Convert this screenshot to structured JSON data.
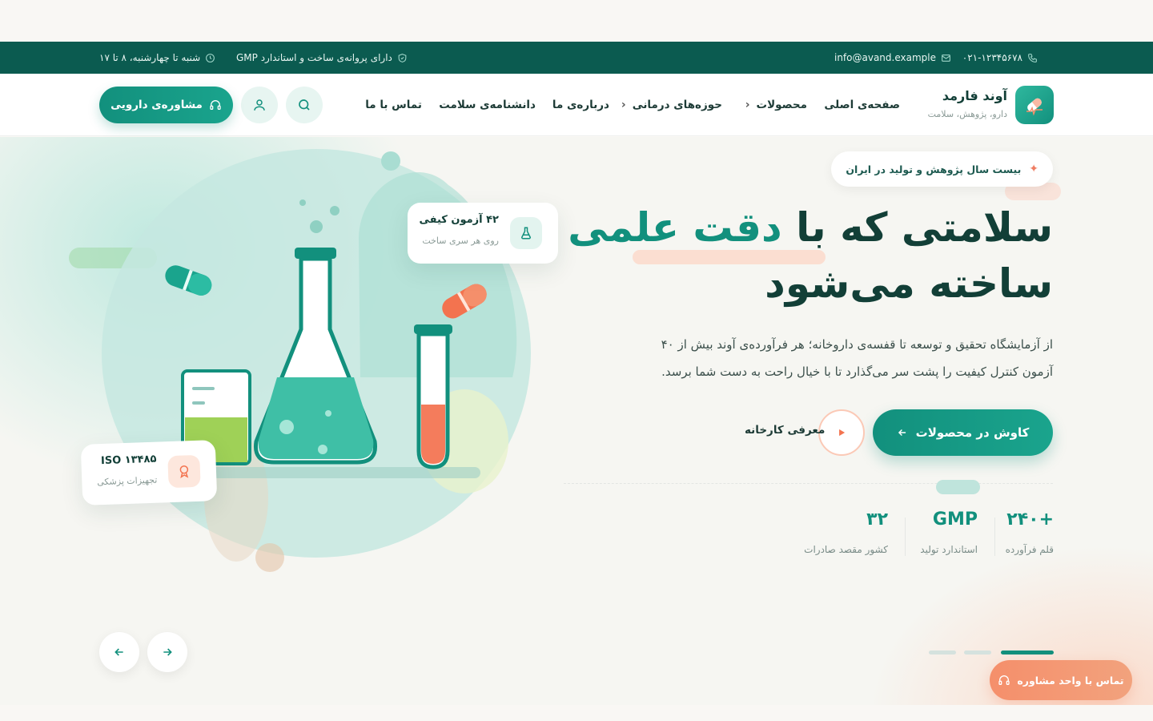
{
  "topbar": {
    "phone": "۰۲۱-۱۲۳۴۵۶۷۸",
    "email": "info@avand.example",
    "license": "دارای پروانه‌ی ساخت و استاندارد GMP",
    "hours": "شنبه تا چهارشنبه، ۸ تا ۱۷"
  },
  "brand": {
    "name": "آوند فارمد",
    "tagline": "دارو، پژوهش، سلامت"
  },
  "nav": {
    "items": [
      "صفحه‌ی اصلی",
      "محصولات",
      "حوزه‌های درمانی",
      "درباره‌ی ما",
      "دانشنامه‌ی سلامت",
      "تماس با ما"
    ],
    "consult_label": "مشاوره‌ی دارویی"
  },
  "hero": {
    "badge": "بیست سال پژوهش و تولید در ایران",
    "title_pre": "سلامتی که با",
    "title_accent": "دقت علمی",
    "title_line2": "ساخته می‌شود",
    "description": "از آزمایشگاه تحقیق و توسعه تا قفسه‌ی داروخانه؛ هر فرآورده‌ی آوند بیش از ۴۰ آزمون کنترل کیفیت را پشت سر می‌گذارد تا با خیال راحت به دست شما برسد.",
    "primary_cta": "کاوش در محصولات",
    "video_label": "معرفی کارخانه",
    "stats": [
      {
        "value": "+۲۴۰",
        "label": "قلم فرآورده"
      },
      {
        "value": "GMP",
        "label": "استاندارد تولید"
      },
      {
        "value": "۳۲",
        "label": "کشور مقصد صادرات"
      }
    ],
    "cards": {
      "tests_title": "۴۲ آزمون کیفی",
      "tests_sub": "روی هر سری ساخت",
      "iso_title": "ISO ۱۳۴۸۵",
      "iso_sub": "تجهیزات پزشکی"
    },
    "slider": {
      "count": 3,
      "active": 1
    }
  },
  "float_cta": "تماس با واحد مشاوره",
  "colors": {
    "primary": "#12907d",
    "dark": "#0b5b50",
    "accent": "#f58f6b"
  }
}
